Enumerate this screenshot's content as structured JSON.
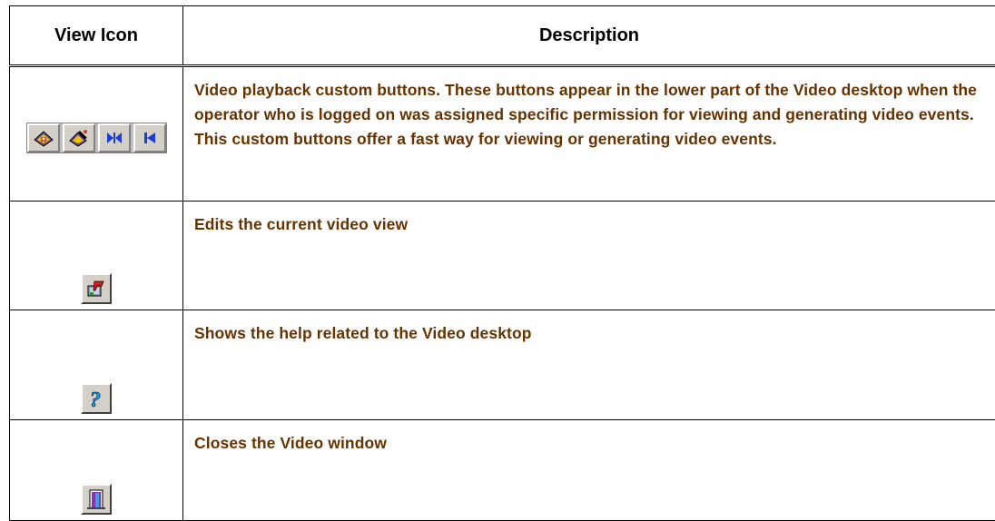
{
  "table": {
    "headers": {
      "view_icon": "View Icon",
      "description": "Description"
    },
    "rows": [
      {
        "icon": "video-playback-custom-buttons-icon",
        "description_bold": "Video playback",
        "description": " custom buttons. These buttons appear in the lower part of the Video desktop when the operator who is logged on was assigned specific permission for viewing and generating video events. This custom buttons offer a fast way for viewing or generating video events."
      },
      {
        "icon": "edit-video-view-icon",
        "description": "Edits the current video view"
      },
      {
        "icon": "help-icon",
        "description": "Shows the help related to the Video desktop"
      },
      {
        "icon": "close-video-window-icon",
        "description": "Closes the Video window"
      }
    ]
  },
  "colors": {
    "description_text": "#663300",
    "header_text": "#000000",
    "border": "#000000"
  }
}
